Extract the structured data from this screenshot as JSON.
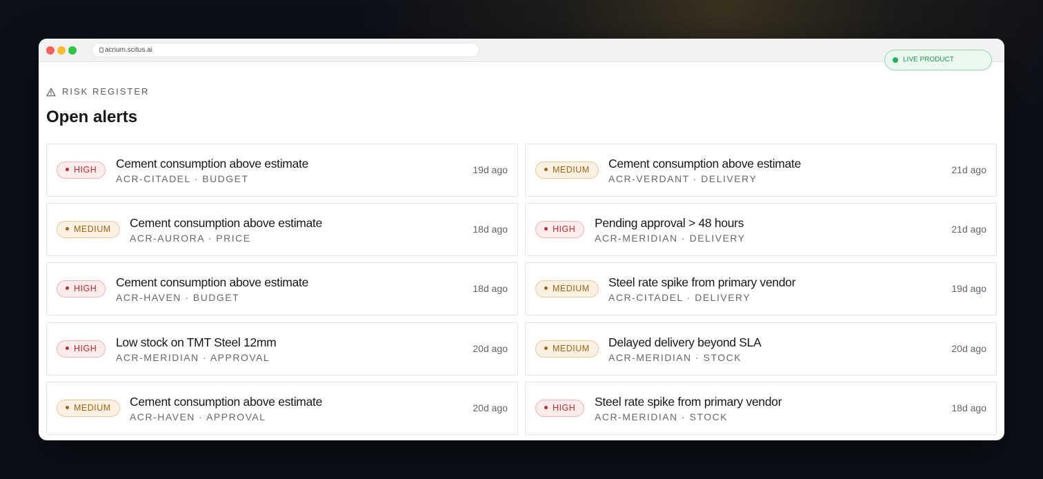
{
  "browser": {
    "url": "acrium.scitus.ai",
    "lock_icon": "lock-icon"
  },
  "live_badge": {
    "label": "LIVE PRODUCT",
    "color": "#22b35a"
  },
  "section": {
    "eyebrow_icon": "warning-triangle-icon",
    "eyebrow": "RISK REGISTER",
    "title": "Open alerts"
  },
  "colors": {
    "high_text": "#c4282b",
    "high_bg": "#fdecec",
    "medium_text": "#a9630f",
    "medium_bg": "#fbf1e2"
  },
  "alerts": [
    {
      "severity": "HIGH",
      "title": "Cement consumption above estimate",
      "meta": "ACR-CITADEL · BUDGET",
      "ago": "19d ago"
    },
    {
      "severity": "MEDIUM",
      "title": "Cement consumption above estimate",
      "meta": "ACR-VERDANT · DELIVERY",
      "ago": "21d ago"
    },
    {
      "severity": "MEDIUM",
      "title": "Cement consumption above estimate",
      "meta": "ACR-AURORA · PRICE",
      "ago": "18d ago"
    },
    {
      "severity": "HIGH",
      "title": "Pending approval > 48 hours",
      "meta": "ACR-MERIDIAN · DELIVERY",
      "ago": "21d ago"
    },
    {
      "severity": "HIGH",
      "title": "Cement consumption above estimate",
      "meta": "ACR-HAVEN · BUDGET",
      "ago": "18d ago"
    },
    {
      "severity": "MEDIUM",
      "title": "Steel rate spike from primary vendor",
      "meta": "ACR-CITADEL · DELIVERY",
      "ago": "19d ago"
    },
    {
      "severity": "HIGH",
      "title": "Low stock on TMT Steel 12mm",
      "meta": "ACR-MERIDIAN · APPROVAL",
      "ago": "20d ago"
    },
    {
      "severity": "MEDIUM",
      "title": "Delayed delivery beyond SLA",
      "meta": "ACR-MERIDIAN · STOCK",
      "ago": "20d ago"
    },
    {
      "severity": "MEDIUM",
      "title": "Cement consumption above estimate",
      "meta": "ACR-HAVEN · APPROVAL",
      "ago": "20d ago"
    },
    {
      "severity": "HIGH",
      "title": "Steel rate spike from primary vendor",
      "meta": "ACR-MERIDIAN · STOCK",
      "ago": "18d ago"
    }
  ]
}
